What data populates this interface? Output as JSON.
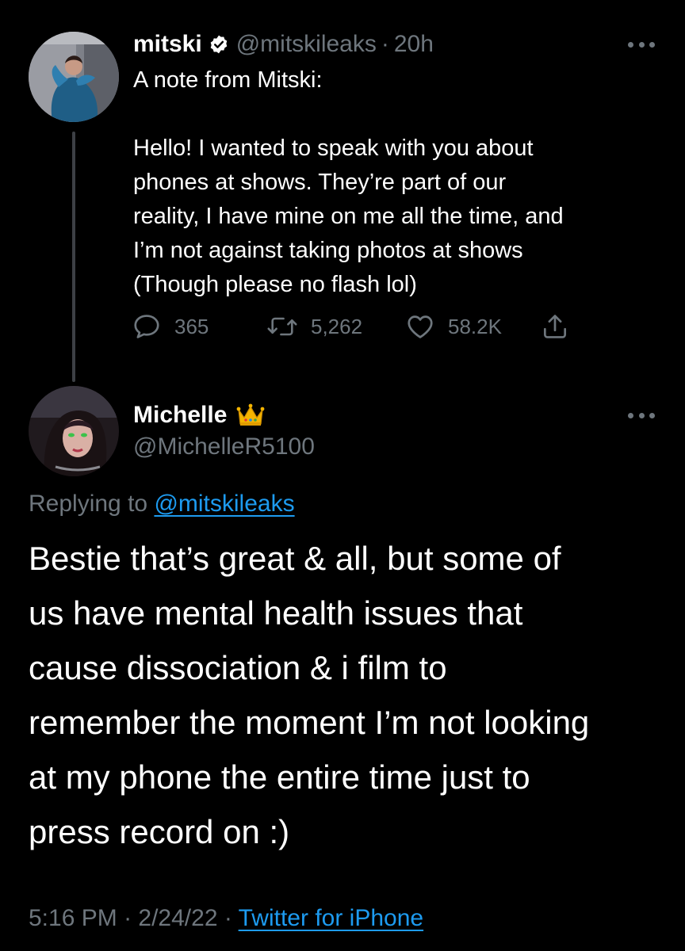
{
  "tweet": {
    "author": {
      "display_name": "mitski",
      "handle": "@mitskileaks",
      "time_ago": "20h",
      "verified": true
    },
    "lines": [
      "A note from Mitski:",
      "",
      "Hello! I wanted to speak with you about",
      "phones at shows. They’re part of our",
      "reality, I have mine on me all the time, and",
      "I’m not against taking photos at shows",
      "(Though please no flash lol)"
    ],
    "actions": {
      "replies": "365",
      "retweets": "5,262",
      "likes": "58.2K"
    }
  },
  "reply": {
    "author": {
      "display_name": "Michelle",
      "handle": "@MichelleR5100",
      "badge_emoji": "crown"
    },
    "replying_prefix": "Replying to",
    "replying_to": "@mitskileaks",
    "lines": [
      "Bestie that’s great & all, but some of",
      "us have mental health issues that",
      "cause dissociation & i film to",
      "remember the moment I’m not looking",
      "at my phone the entire time just to",
      "press record on :)"
    ],
    "time": "5:16 PM",
    "date": "2/24/22",
    "source": "Twitter for iPhone"
  },
  "colors": {
    "background": "#000000",
    "text": "#ffffff",
    "secondary": "#6e767d",
    "link": "#1d9bf0",
    "verified": "#ffffff",
    "thread_line": "#3d4045"
  },
  "icons": [
    "verified-badge-icon",
    "more-icon",
    "reply-icon",
    "retweet-icon",
    "like-icon",
    "share-icon",
    "crown-emoji"
  ]
}
